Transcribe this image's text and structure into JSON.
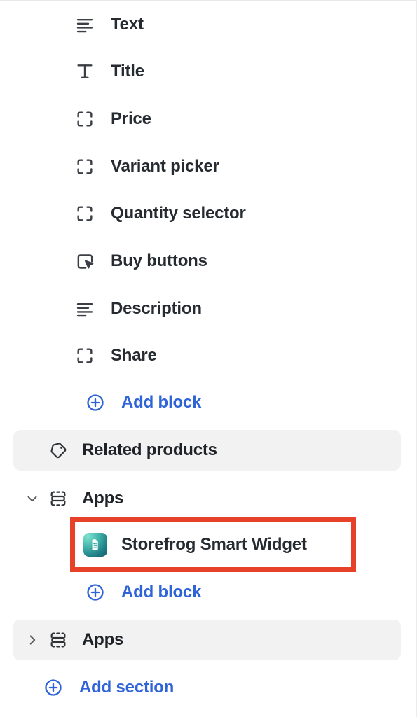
{
  "panel": {
    "accent_blue": "#2f63d8",
    "highlight_red": "#e8412a",
    "section_bg": "#f2f2f2",
    "text_color": "#262b31"
  },
  "blocks": [
    {
      "label": "Text",
      "icon": "text-align-left-icon"
    },
    {
      "label": "Title",
      "icon": "title-t-icon"
    },
    {
      "label": "Price",
      "icon": "corner-brackets-icon"
    },
    {
      "label": "Variant picker",
      "icon": "corner-brackets-icon"
    },
    {
      "label": "Quantity selector",
      "icon": "corner-brackets-icon"
    },
    {
      "label": "Buy buttons",
      "icon": "cursor-button-icon"
    },
    {
      "label": "Description",
      "icon": "text-align-left-icon"
    },
    {
      "label": "Share",
      "icon": "corner-brackets-icon"
    }
  ],
  "add_block_1": {
    "label": "Add block",
    "icon": "circle-plus-icon"
  },
  "related_products": {
    "label": "Related products",
    "icon": "tag-icon"
  },
  "apps_expanded": {
    "label": "Apps",
    "icon": "app-block-icon",
    "chevron": "chevron-down-icon",
    "expanded": true
  },
  "app_block": {
    "label": "Storefrog Smart Widget",
    "icon": "storefrog-app-icon",
    "highlighted": true
  },
  "add_block_2": {
    "label": "Add block",
    "icon": "circle-plus-icon"
  },
  "apps_collapsed": {
    "label": "Apps",
    "icon": "app-block-icon",
    "chevron": "chevron-right-icon",
    "expanded": false
  },
  "add_section": {
    "label": "Add section",
    "icon": "circle-plus-icon"
  }
}
